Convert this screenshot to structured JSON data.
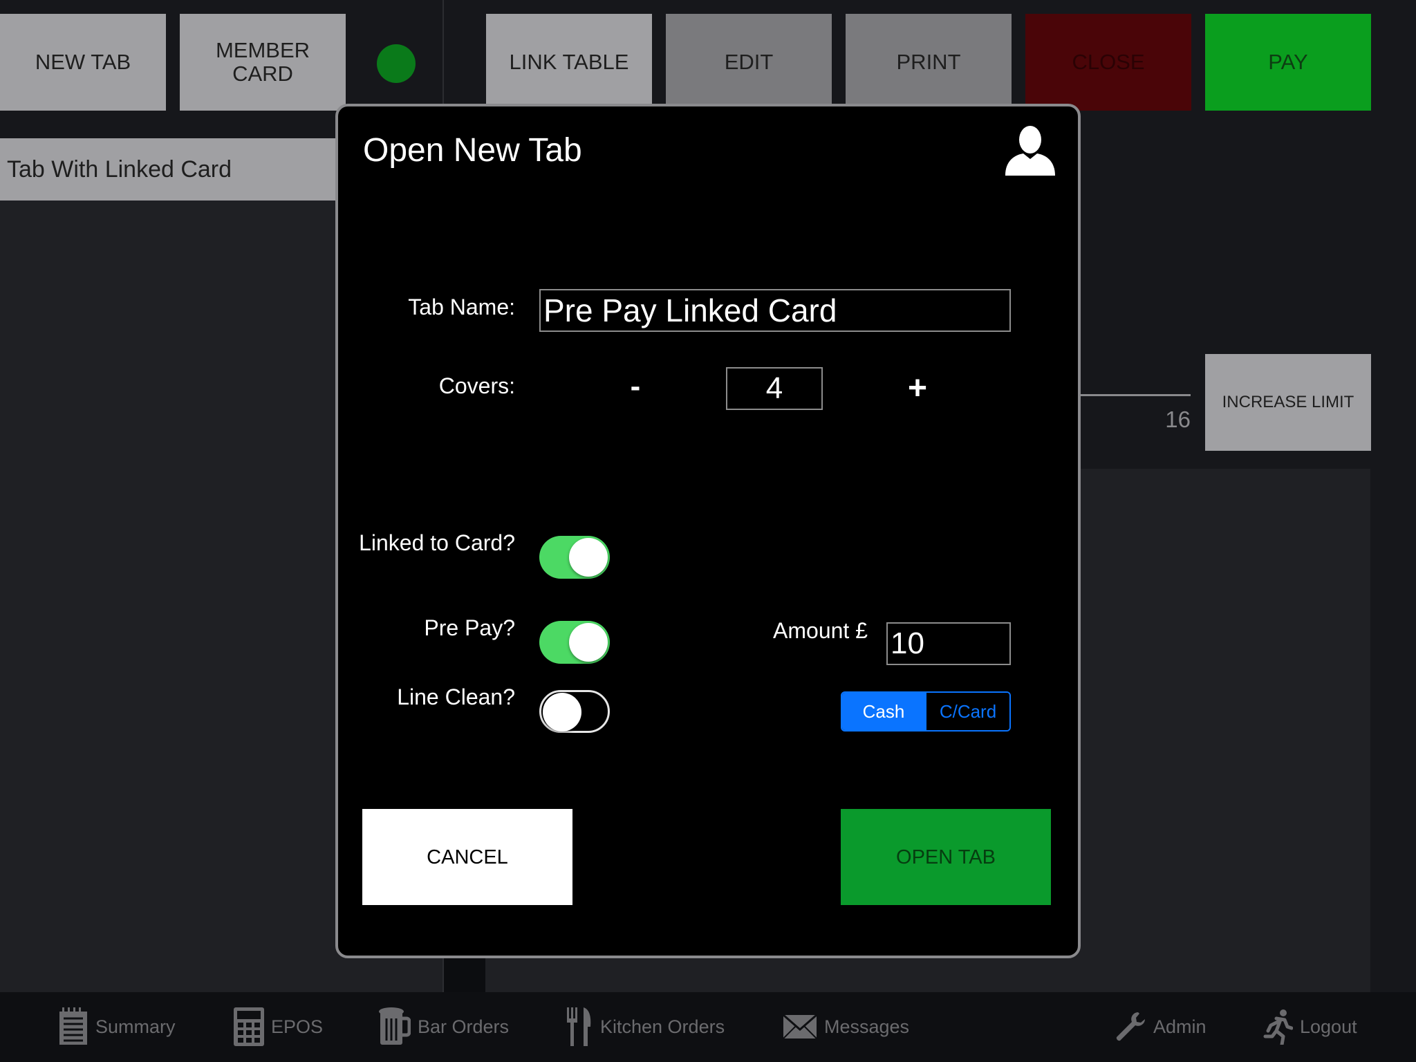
{
  "toolbar": {
    "new_tab": "NEW TAB",
    "member_card_line1": "MEMBER",
    "member_card_line2": "CARD",
    "link_table": "LINK TABLE",
    "edit": "EDIT",
    "print": "PRINT",
    "close": "CLOSE",
    "pay": "PAY"
  },
  "tab_list": {
    "items": [
      {
        "label": "Tab With Linked Card"
      }
    ]
  },
  "limit": {
    "increase_label": "INCREASE LIMIT",
    "value": "16"
  },
  "dialog": {
    "title": "Open New Tab",
    "tab_name_label": "Tab Name:",
    "tab_name_value": "Pre Pay Linked Card",
    "covers_label": "Covers:",
    "covers_minus": "-",
    "covers_value": "4",
    "covers_plus": "+",
    "linked_label": "Linked to Card?",
    "linked_on": true,
    "prepay_label": "Pre Pay?",
    "prepay_on": true,
    "lineclean_label": "Line Clean?",
    "lineclean_on": false,
    "amount_label": "Amount £",
    "amount_value": "10",
    "payment_methods": [
      "Cash",
      "C/Card"
    ],
    "payment_selected": "Cash",
    "cancel": "CANCEL",
    "open_tab": "OPEN TAB"
  },
  "bottom_nav": {
    "items": [
      "Summary",
      "EPOS",
      "Bar Orders",
      "Kitchen Orders",
      "Messages",
      "Admin",
      "Logout"
    ]
  },
  "colors": {
    "status_indicator": "#0a7a1a",
    "close_button": "#4a0508",
    "pay_button": "#0a9e1e",
    "open_tab_button": "#0a9a2c",
    "toggle_on": "#4cd964",
    "segment_blue": "#0a74ff"
  }
}
